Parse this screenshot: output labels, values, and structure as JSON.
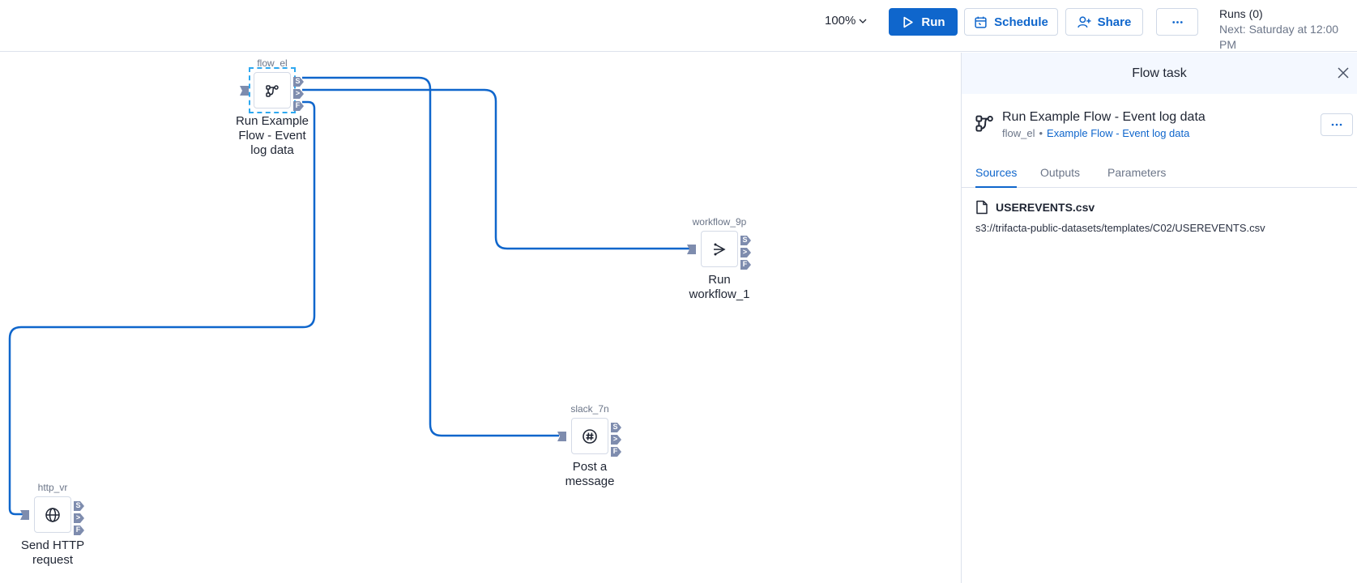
{
  "toolbar": {
    "zoom_level": "100%",
    "run_label": "Run",
    "schedule_label": "Schedule",
    "share_label": "Share",
    "more_label": "···",
    "runs_count": "Runs (0)",
    "next_run": "Next: Saturday at 12:00 PM"
  },
  "colors": {
    "accent": "#0f66cc",
    "edge": "#0f66cc",
    "port": "#7e8cae",
    "selection": "#2ea8f0"
  },
  "nodes": [
    {
      "id": "flow_el",
      "label": "Run Example Flow - Event log data",
      "icon": "flow-icon",
      "selected": true
    },
    {
      "id": "workflow_9p",
      "label": "Run workflow_1",
      "icon": "workflow-icon",
      "selected": false
    },
    {
      "id": "slack_7n",
      "label": "Post a message",
      "icon": "slack-icon",
      "selected": false
    },
    {
      "id": "http_vr",
      "label": "Send HTTP request",
      "icon": "globe-icon",
      "selected": false
    }
  ],
  "ports": {
    "success": "S",
    "next": ">",
    "failure": "F"
  },
  "edges": [
    {
      "from": "flow_el",
      "port": "S",
      "to": "slack_7n"
    },
    {
      "from": "flow_el",
      "port": ">",
      "to": "workflow_9p"
    },
    {
      "from": "flow_el",
      "port": "F",
      "to": "http_vr"
    }
  ],
  "panel": {
    "title": "Flow task",
    "task_title": "Run Example Flow - Event log data",
    "task_id": "flow_el",
    "task_link": "Example Flow - Event log data",
    "tabs": [
      {
        "label": "Sources",
        "active": true
      },
      {
        "label": "Outputs",
        "active": false
      },
      {
        "label": "Parameters",
        "active": false
      }
    ],
    "source": {
      "name": "USEREVENTS.csv",
      "path": "s3://trifacta-public-datasets/templates/C02/USEREVENTS.csv"
    }
  }
}
